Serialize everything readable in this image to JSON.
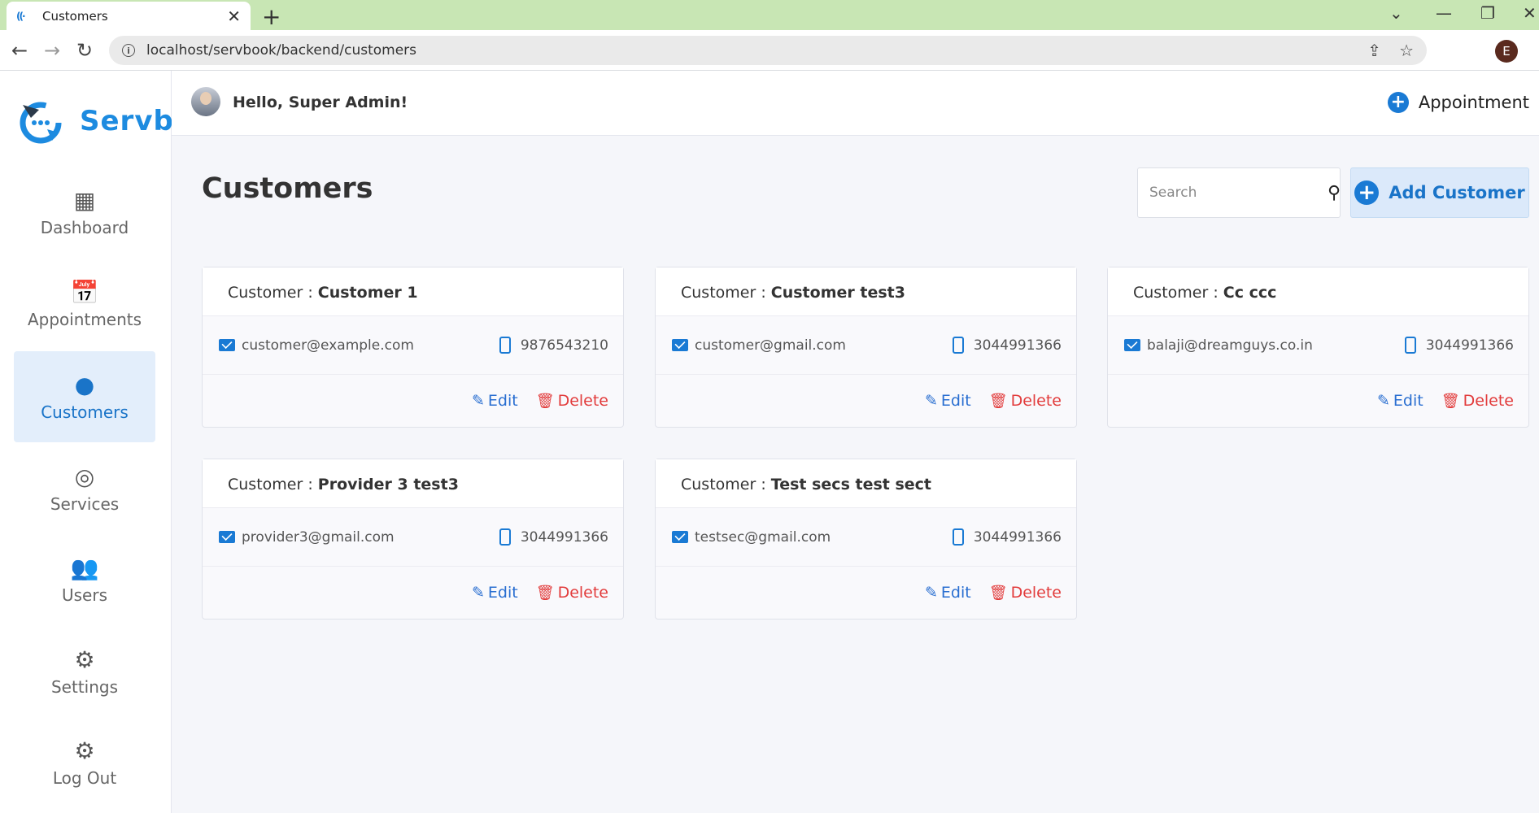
{
  "browser": {
    "tab_title": "Customers",
    "tab_close": "✕",
    "new_tab": "+",
    "url": "localhost/servbook/backend/customers",
    "profile_initial": "E"
  },
  "sidebar": {
    "logo_text": "Servbo",
    "items": [
      {
        "label": "Dashboard",
        "icon": "dashboard-icon"
      },
      {
        "label": "Appointments",
        "icon": "calendar-icon"
      },
      {
        "label": "Customers",
        "icon": "user-circle-icon"
      },
      {
        "label": "Services",
        "icon": "palette-icon"
      },
      {
        "label": "Users",
        "icon": "users-icon"
      },
      {
        "label": "Settings",
        "icon": "gear-icon"
      },
      {
        "label": "Log Out",
        "icon": "gear-icon"
      }
    ],
    "active": "Customers"
  },
  "header": {
    "greeting": "Hello, Super Admin!",
    "appointment_label": "Appointment"
  },
  "page": {
    "title": "Customers",
    "search_placeholder": "Search",
    "add_label": "Add Customer"
  },
  "customers": [
    {
      "prefix": "Customer : ",
      "name": "Customer 1",
      "email": "customer@example.com",
      "phone": "9876543210"
    },
    {
      "prefix": "Customer : ",
      "name": "Customer test3",
      "email": "customer@gmail.com",
      "phone": "3044991366"
    },
    {
      "prefix": "Customer : ",
      "name": "Cc ccc",
      "email": "balaji@dreamguys.co.in",
      "phone": "3044991366"
    },
    {
      "prefix": "Customer : ",
      "name": "Provider 3 test3",
      "email": "provider3@gmail.com",
      "phone": "3044991366"
    },
    {
      "prefix": "Customer : ",
      "name": "Test secs test sect",
      "email": "testsec@gmail.com",
      "phone": "3044991366"
    }
  ],
  "actions": {
    "edit": "Edit",
    "delete": "Delete"
  },
  "colors": {
    "accent": "#1a7ad4",
    "danger": "#e23b3b",
    "active_bg": "#e3eefb",
    "tabbar": "#c8e6b4"
  }
}
